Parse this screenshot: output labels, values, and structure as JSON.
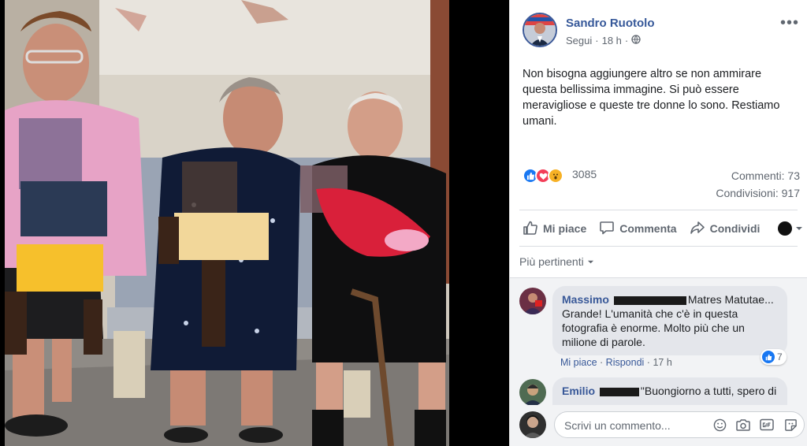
{
  "post": {
    "author": "Sandro Ruotolo",
    "follow_label": "Segui",
    "time": "18 h",
    "text": "Non bisogna aggiungere altro se non ammirare questa bellissima immagine. Si può essere meravigliose e queste tre donne lo sono. Restiamo umani.",
    "reactions_count": "3085",
    "comments_count": "Commenti: 73",
    "shares_count": "Condivisioni: 917",
    "more_label": "•••"
  },
  "actions": {
    "like": "Mi piace",
    "comment": "Commenta",
    "share": "Condividi"
  },
  "filter_label": "Più pertinenti",
  "comments": [
    {
      "name": "Massimo",
      "text_after_redact": "Matres Matutae...",
      "body": "Grande! L'umanità che c'è in questa fotografia è enorme. Molto più che un milione di parole.",
      "like_action": "Mi piace",
      "reply_action": "Rispondi",
      "time": "17 h",
      "likes": "7"
    },
    {
      "name": "Emilio",
      "text_after_redact": "\"Buongiorno a tutti, spero di"
    }
  ],
  "composer": {
    "placeholder": "Scrivi un commento..."
  },
  "colors": {
    "brand_link": "#365899",
    "like_blue": "#1877f2",
    "love_red": "#f33e58",
    "wow_yellow": "#f7b125"
  },
  "icons": {
    "globe": "globe-icon",
    "like": "thumbs-up-icon",
    "comment": "speech-bubble-icon",
    "share": "share-arrow-icon",
    "emoji": "emoji-icon",
    "camera": "camera-icon",
    "gif": "gif-icon",
    "sticker": "sticker-icon"
  }
}
